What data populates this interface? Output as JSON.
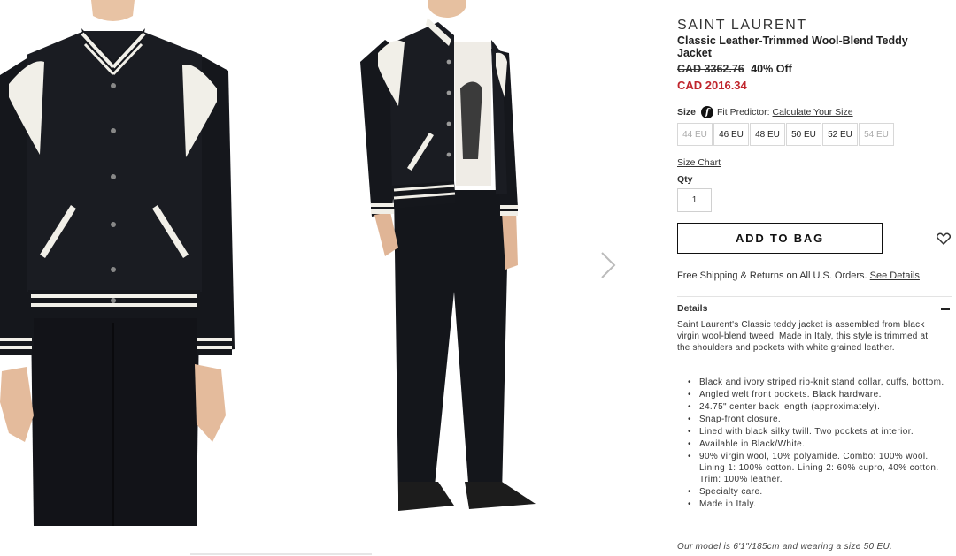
{
  "brand": "SAINT LAURENT",
  "product_title": "Classic Leather-Trimmed Wool-Blend Teddy Jacket",
  "price": {
    "original": "CAD 3362.76",
    "discount": "40% Off",
    "sale": "CAD 2016.34"
  },
  "size": {
    "label": "Size",
    "fit_predictor_label": "Fit Predictor:",
    "fit_predictor_link": "Calculate Your Size",
    "options": [
      {
        "label": "44 EU",
        "available": false
      },
      {
        "label": "46 EU",
        "available": true
      },
      {
        "label": "48 EU",
        "available": true
      },
      {
        "label": "50 EU",
        "available": true
      },
      {
        "label": "52 EU",
        "available": true
      },
      {
        "label": "54 EU",
        "available": false
      }
    ],
    "chart_link": "Size Chart"
  },
  "qty": {
    "label": "Qty",
    "value": "1"
  },
  "add_to_bag": "ADD TO BAG",
  "shipping": {
    "text": "Free Shipping & Returns on All U.S. Orders.",
    "link": "See Details"
  },
  "details": {
    "heading": "Details",
    "description": "Saint Laurent's Classic teddy jacket is assembled from black virgin wool-blend tweed. Made in Italy, this style is trimmed at the shoulders and pockets with white grained leather.",
    "bullets": [
      "Black and ivory striped rib-knit stand collar, cuffs, bottom.",
      "Angled welt front pockets. Black hardware.",
      "24.75\" center back length (approximately).",
      "Snap-front closure.",
      "Lined with black silky twill. Two pockets at interior.",
      "Available in Black/White.",
      "90% virgin wool, 10% polyamide. Combo: 100% wool. Lining 1: 100% cotton. Lining 2: 60% cupro, 40% cotton. Trim: 100% leather.",
      "Specialty care.",
      "Made in Italy."
    ],
    "model_note": "Our model is 6'1\"/185cm and wearing a size 50 EU."
  },
  "colors": {
    "sale_price": "#c0262d",
    "jacket": "#15171c",
    "trim": "#f1efe8"
  },
  "icons": {
    "next": "chevron-right-icon",
    "wishlist": "heart-icon",
    "fit": "fit-predictor-icon",
    "collapse": "minus-icon"
  }
}
